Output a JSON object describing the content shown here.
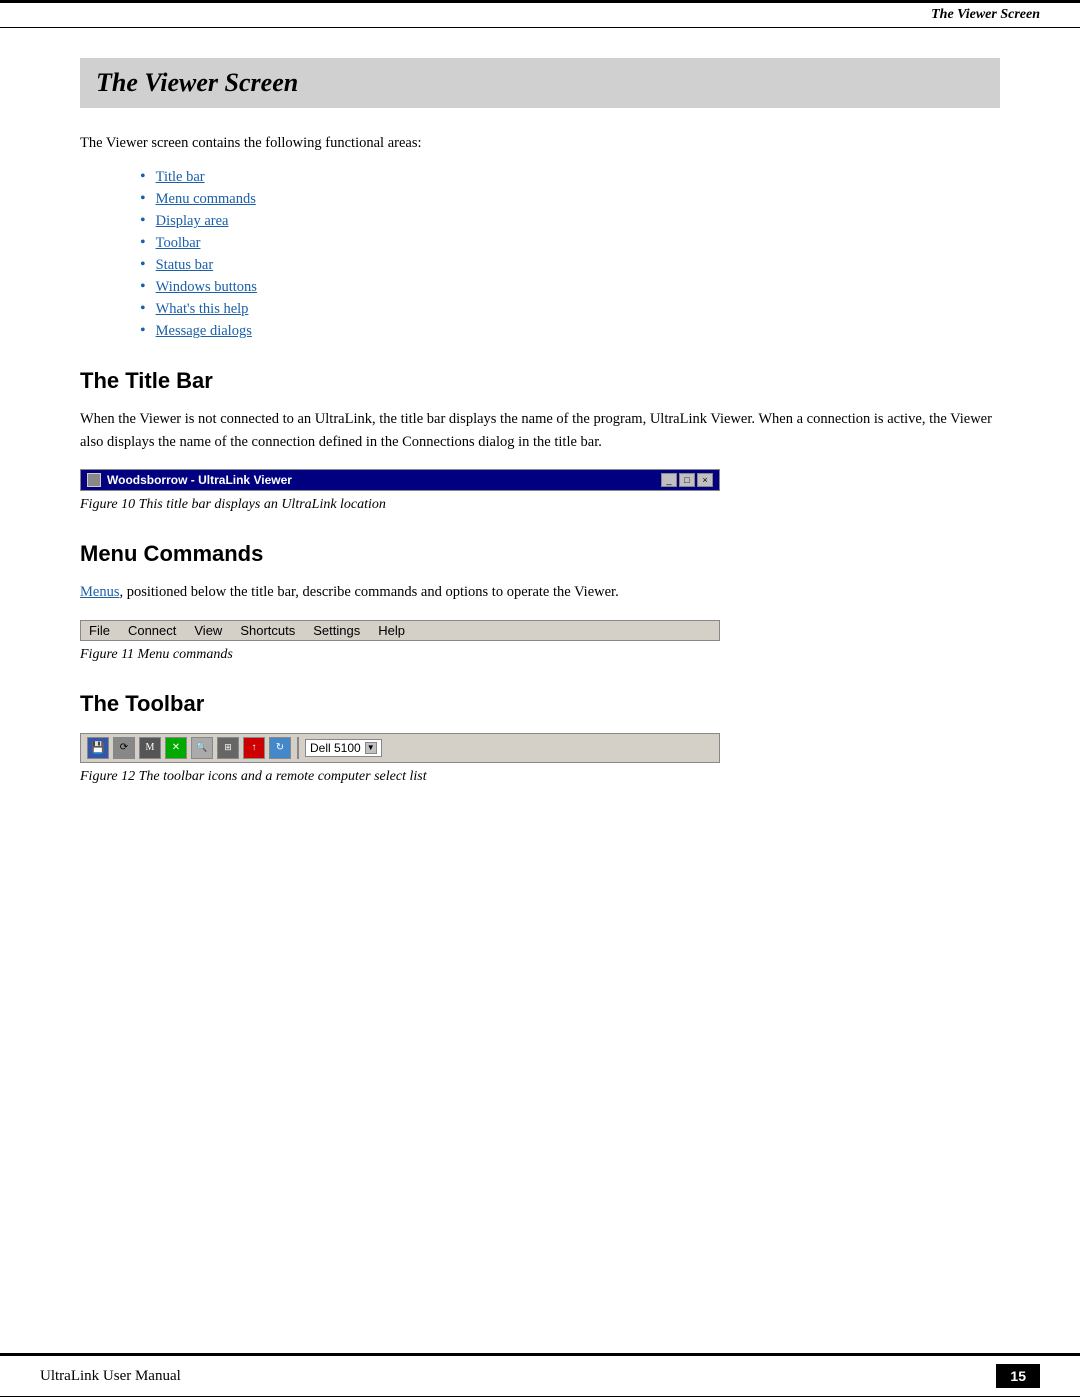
{
  "header": {
    "label": "The Viewer Screen"
  },
  "chapter": {
    "title": "The Viewer Screen",
    "intro": "The Viewer screen contains the following functional areas:",
    "links": [
      {
        "text": "Title bar"
      },
      {
        "text": "Menu commands"
      },
      {
        "text": "Display area"
      },
      {
        "text": "Toolbar"
      },
      {
        "text": "Status bar"
      },
      {
        "text": "Windows buttons"
      },
      {
        "text": "What's this help"
      },
      {
        "text": "Message dialogs"
      }
    ]
  },
  "title_bar_section": {
    "heading": "The Title Bar",
    "body": "When the Viewer is not connected to an UltraLink, the title bar displays the name of the program, UltraLink Viewer. When a connection is active, the Viewer also displays the name of the connection defined in the Connections dialog in the title bar.",
    "figure_title": "Woodsborrow - UltraLink Viewer",
    "figure_buttons": [
      "_",
      "□",
      "×"
    ],
    "caption": "Figure 10 This title bar displays an UltraLink location"
  },
  "menu_commands_section": {
    "heading": "Menu Commands",
    "body_link": "Menus",
    "body_rest": ", positioned below the title bar, describe commands and options to operate the Viewer.",
    "menu_items": [
      "File",
      "Connect",
      "View",
      "Shortcuts",
      "Settings",
      "Help"
    ],
    "caption": "Figure 11 Menu commands"
  },
  "toolbar_section": {
    "heading": "The Toolbar",
    "toolbar_dropdown_label": "Dell 5100",
    "caption": "Figure 12 The toolbar icons and a remote computer select list"
  },
  "footer": {
    "label": "UltraLink User Manual",
    "page": "15"
  }
}
